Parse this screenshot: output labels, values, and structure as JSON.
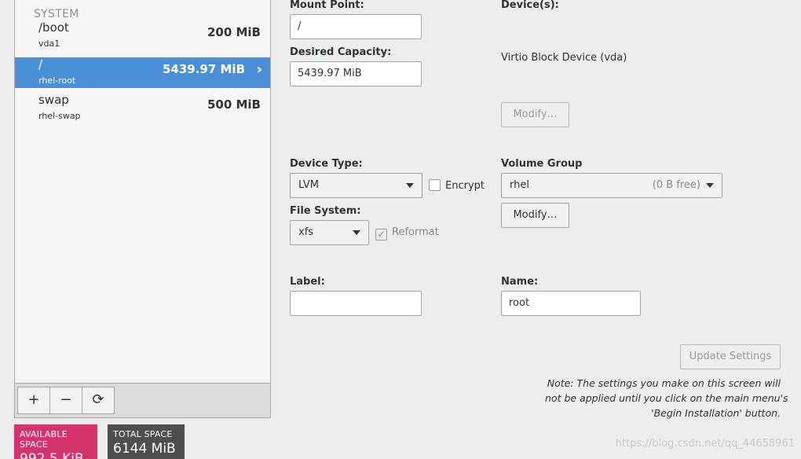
{
  "partitions": {
    "section_title": "SYSTEM",
    "items": [
      {
        "name": "/boot",
        "device": "vda1",
        "size": "200 MiB"
      },
      {
        "name": "/",
        "device": "rhel-root",
        "size": "5439.97 MiB"
      },
      {
        "name": "swap",
        "device": "rhel-swap",
        "size": "500 MiB"
      }
    ],
    "selected_index": 1,
    "toolbar": {
      "add": "+",
      "remove": "−",
      "refresh": "⟳"
    }
  },
  "space": {
    "available_label": "AVAILABLE SPACE",
    "available_value": "992.5 KiB",
    "total_label": "TOTAL SPACE",
    "total_value": "6144 MiB"
  },
  "form": {
    "mount_point_label": "Mount Point:",
    "mount_point_value": "/",
    "desired_capacity_label": "Desired Capacity:",
    "desired_capacity_value": "5439.97 MiB",
    "devices_label": "Device(s):",
    "device_name": "Virtio Block Device (vda)",
    "devices_modify": "Modify…",
    "device_type_label": "Device Type:",
    "device_type_value": "LVM",
    "encrypt_label": "Encrypt",
    "volume_group_label": "Volume Group",
    "volume_group_value": "rhel",
    "volume_group_free": "(0 B free)",
    "volume_group_modify": "Modify…",
    "file_system_label": "File System:",
    "file_system_value": "xfs",
    "reformat_label": "Reformat",
    "label_label": "Label:",
    "label_value": "",
    "name_label": "Name:",
    "name_value": "root",
    "update_button": "Update Settings",
    "note_lines": [
      "Note:  The settings you make on this screen will",
      "not be applied until you click on the main menu's",
      "'Begin Installation' button."
    ]
  },
  "watermark": "https://blog.csdn.net/qq_44658961",
  "colors": {
    "selected_row": "#4a90d9",
    "available_space": "#d6336c",
    "total_space": "#4d4f4e"
  }
}
